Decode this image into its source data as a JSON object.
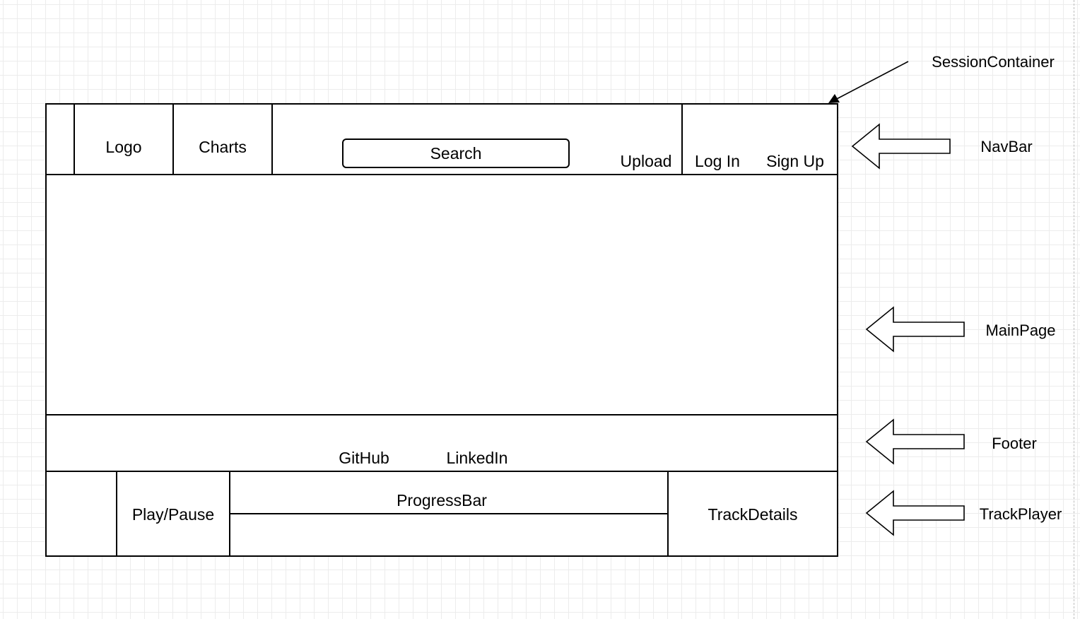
{
  "navbar": {
    "logo": "Logo",
    "charts": "Charts",
    "search": "Search",
    "upload": "Upload",
    "login": "Log In",
    "signup": "Sign Up"
  },
  "footer": {
    "github": "GitHub",
    "linkedin": "LinkedIn"
  },
  "trackplayer": {
    "play_pause": "Play/Pause",
    "progress_bar": "ProgressBar",
    "track_details": "TrackDetails"
  },
  "annotations": {
    "session_container": "SessionContainer",
    "navbar": "NavBar",
    "main_page": "MainPage",
    "footer": "Footer",
    "track_player": "TrackPlayer"
  }
}
